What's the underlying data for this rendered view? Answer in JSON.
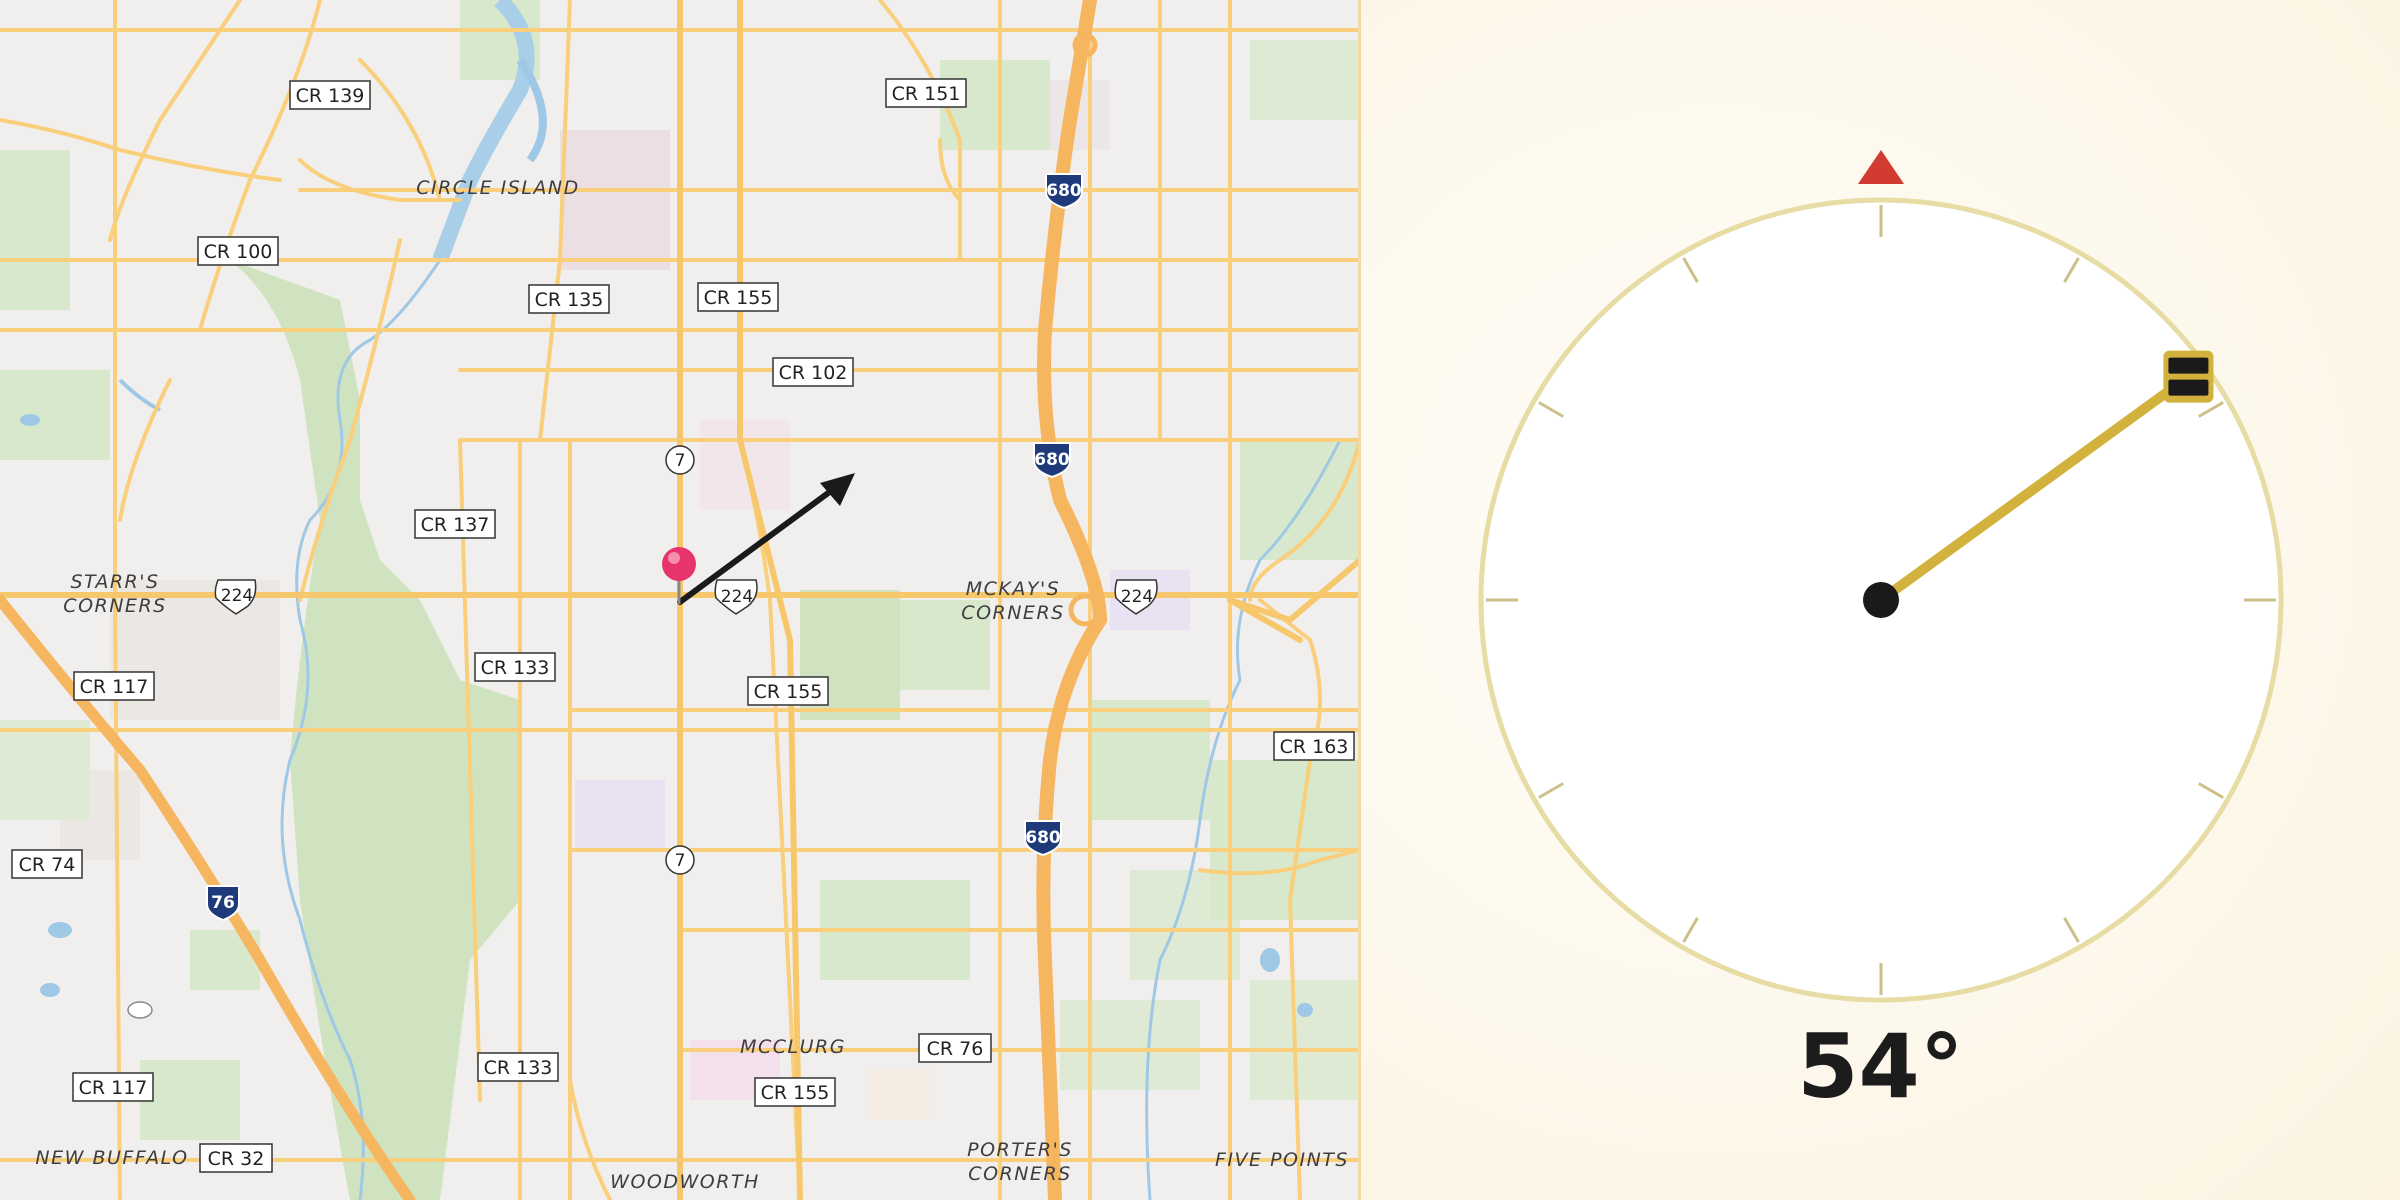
{
  "map": {
    "labels": {
      "cr139": "CR 139",
      "cr151": "CR 151",
      "cr100": "CR 100",
      "cr135": "CR 135",
      "cr155_n": "CR 155",
      "cr102": "CR 102",
      "cr137": "CR 137",
      "cr133_mid": "CR 133",
      "cr155_mid": "CR 155",
      "cr117_n": "CR 117",
      "cr163": "CR 163",
      "cr74": "CR 74",
      "cr133_s": "CR 133",
      "cr76": "CR 76",
      "cr117_s": "CR 117",
      "cr155_s": "CR 155",
      "cr32": "CR 32"
    },
    "places": {
      "circle_island": "CIRCLE ISLAND",
      "starrs_1": "STARR'S",
      "starrs_2": "CORNERS",
      "mckays_1": "MCKAY'S",
      "mckays_2": "CORNERS",
      "mcclurg": "MCCLURG",
      "new_buffalo": "NEW BUFFALO",
      "porters_1": "PORTER'S",
      "porters_2": "CORNERS",
      "five_points": "FIVE POINTS",
      "woodworth": "WOODWORTH"
    },
    "shields": {
      "us224_w": "224",
      "us224_c": "224",
      "us224_e": "224",
      "i680_n": "680",
      "i680_m": "680",
      "i680_s": "680",
      "i76": "76",
      "st7_n": "7",
      "st7_s": "7"
    },
    "colors": {
      "background": "#f1efed",
      "road": "#f9cf7c",
      "highway": "#f6b55f",
      "park": "#cfe3c0",
      "water": "#9fc8e6",
      "pin": "#e8336d"
    }
  },
  "compass": {
    "heading_deg": 54,
    "heading_text": "54°",
    "north_marker": "triangle",
    "colors": {
      "ring": "#e6dca4",
      "needle": "#d2b23c",
      "north_marker": "#d23b31",
      "hub": "#1a1a1a"
    }
  },
  "icons": {
    "location_pin": "map-pin-icon",
    "direction_arrow": "direction-arrow-icon",
    "north_marker": "north-triangle-icon",
    "needle_tip": "needle-tip-icon"
  }
}
